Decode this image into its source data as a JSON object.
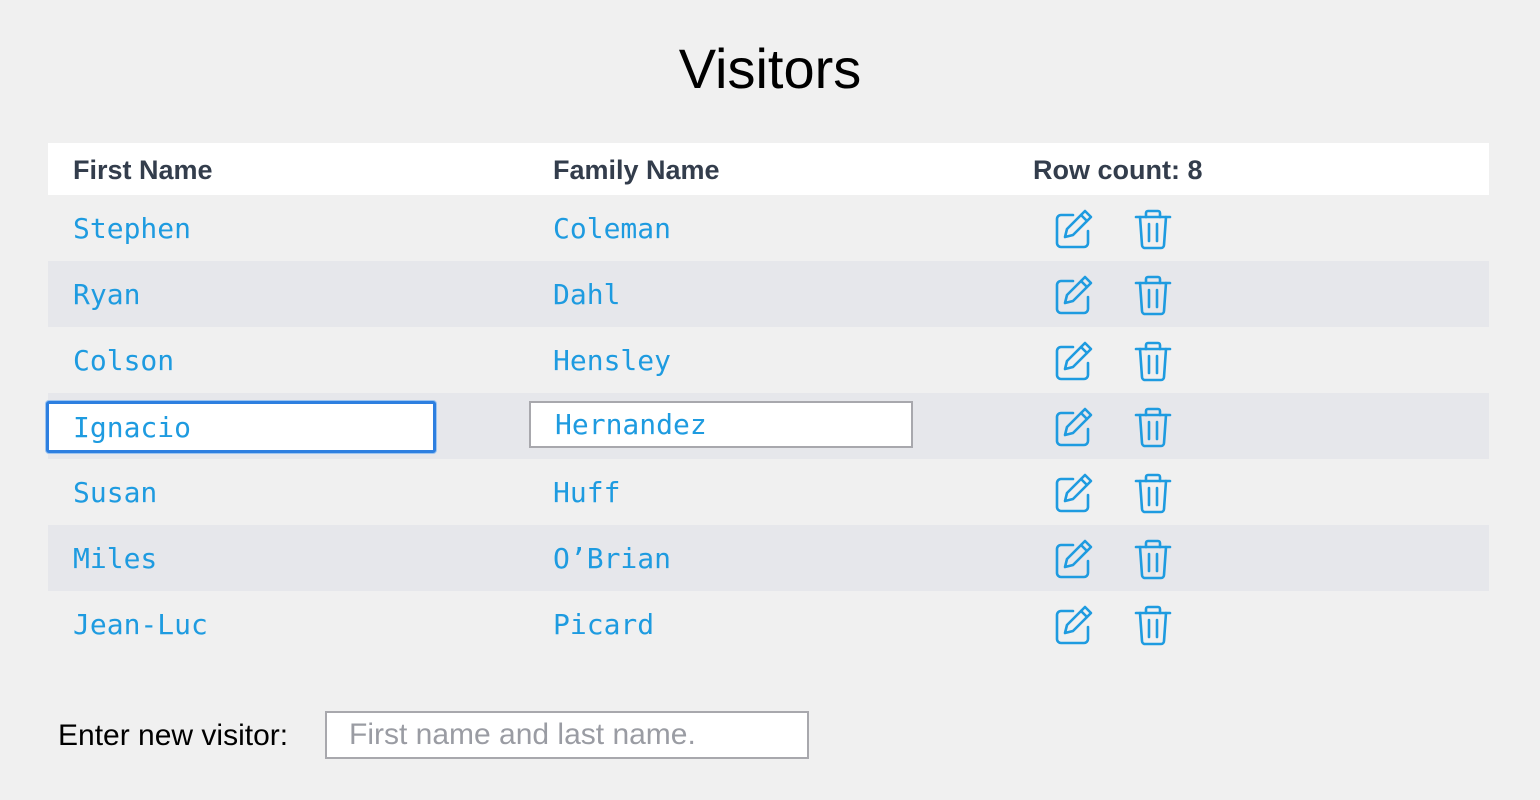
{
  "page": {
    "title": "Visitors"
  },
  "table": {
    "headers": {
      "first_name": "First Name",
      "family_name": "Family Name",
      "row_count": "Row count: 8"
    },
    "rows": [
      {
        "first": "Stephen",
        "last": "Coleman",
        "editing": false
      },
      {
        "first": "Ryan",
        "last": "Dahl",
        "editing": false
      },
      {
        "first": "Colson",
        "last": "Hensley",
        "editing": false
      },
      {
        "first": "Ignacio",
        "last": "Hernandez",
        "editing": true
      },
      {
        "first": "Susan",
        "last": "Huff",
        "editing": false
      },
      {
        "first": "Miles",
        "last": "O’Brian",
        "editing": false
      },
      {
        "first": "Jean-Luc",
        "last": "Picard",
        "editing": false
      }
    ],
    "row_icons": [
      "edit-icon",
      "trash-icon"
    ]
  },
  "new_visitor": {
    "label": "Enter new visitor:",
    "placeholder": "First name and last name.",
    "value": ""
  },
  "colors": {
    "accent": "#1e9be0",
    "header_text": "#333d4c",
    "focus_border": "#2d7fe0",
    "alt_row": "#e6e7eb",
    "background": "#f0f0f0"
  }
}
